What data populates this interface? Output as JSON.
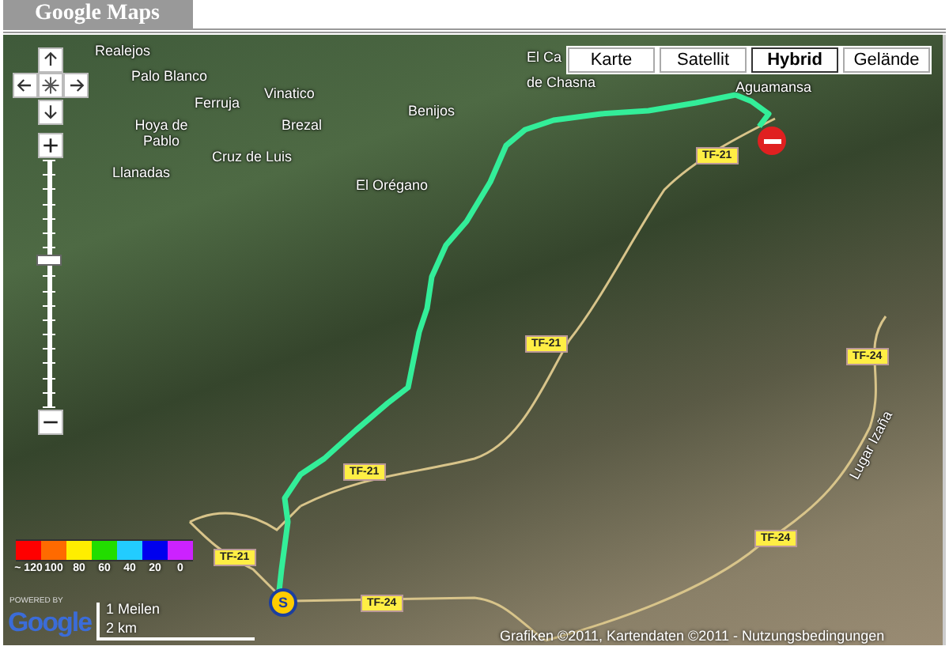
{
  "header": {
    "title": "Google Maps"
  },
  "map": {
    "map_types": [
      {
        "label": "Karte",
        "selected": false
      },
      {
        "label": "Satellit",
        "selected": false
      },
      {
        "label": "Hybrid",
        "selected": true
      },
      {
        "label": "Gelände",
        "selected": false
      }
    ],
    "zoom": {
      "level": 0.6
    },
    "place_labels": [
      "Realejos",
      "Palo Blanco",
      "Vinatico",
      "Ferruja",
      "Benijos",
      "Hoya de Pablo",
      "Brezal",
      "Cruz de Luis",
      "Llanadas",
      "El Orégano",
      "El Ca",
      "de Chasna",
      "Aguamansa",
      "Lugar Izaña"
    ],
    "road_labels": [
      "TF-21",
      "TF-21",
      "TF-21",
      "TF-21",
      "TF-24",
      "TF-24",
      "TF-24"
    ],
    "markers": [
      {
        "kind": "start",
        "label": "S"
      },
      {
        "kind": "end"
      }
    ],
    "legend": [
      {
        "color": "#ff0000",
        "label": "~ 120"
      },
      {
        "color": "#ff6a00",
        "label": "100"
      },
      {
        "color": "#ffee00",
        "label": "80"
      },
      {
        "color": "#22dd00",
        "label": "60"
      },
      {
        "color": "#22ccff",
        "label": "40"
      },
      {
        "color": "#0000ee",
        "label": "20"
      },
      {
        "color": "#cc22ff",
        "label": "0"
      }
    ],
    "scale": {
      "imperial": "1 Meilen",
      "metric": "2 km"
    },
    "powered_by": {
      "caption": "POWERED BY",
      "logo": "Google"
    },
    "copyright": "Grafiken ©2011, Kartendaten ©2011 - ",
    "terms_link": "Nutzungsbedingungen"
  }
}
